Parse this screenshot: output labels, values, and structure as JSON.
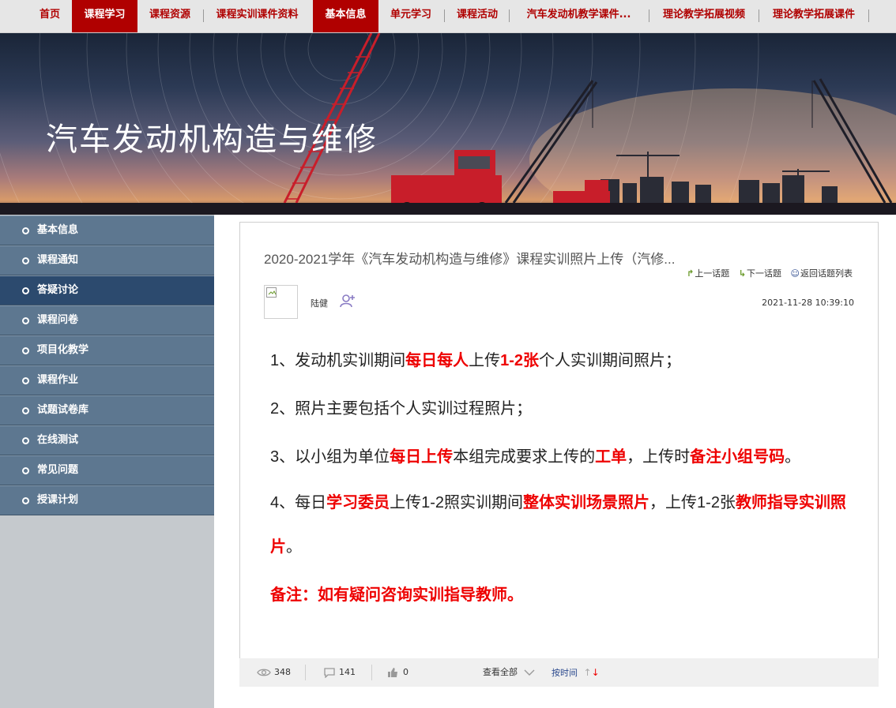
{
  "nav": {
    "items": [
      {
        "label": "首页",
        "active": false
      },
      {
        "label": "课程学习",
        "active": true
      },
      {
        "label": "课程资源",
        "active": false
      },
      {
        "label": "课程实训课件资料",
        "active": false
      },
      {
        "label": "基本信息",
        "active": true
      },
      {
        "label": "单元学习",
        "active": false
      },
      {
        "label": "课程活动",
        "active": false
      },
      {
        "label": "汽车发动机教学课件...",
        "active": false
      },
      {
        "label": "理论教学拓展视频",
        "active": false
      },
      {
        "label": "理论教学拓展课件",
        "active": false
      }
    ]
  },
  "banner": {
    "title": "汽车发动机构造与维修"
  },
  "sidebar": {
    "items": [
      {
        "label": "基本信息",
        "active": false
      },
      {
        "label": "课程通知",
        "active": false
      },
      {
        "label": "答疑讨论",
        "active": true
      },
      {
        "label": "课程问卷",
        "active": false
      },
      {
        "label": "项目化教学",
        "active": false
      },
      {
        "label": "课程作业",
        "active": false
      },
      {
        "label": "试题试卷库",
        "active": false
      },
      {
        "label": "在线测试",
        "active": false
      },
      {
        "label": "常见问题",
        "active": false
      },
      {
        "label": "授课计划",
        "active": false
      }
    ]
  },
  "post": {
    "title": "2020-2021学年《汽车发动机构造与维修》课程实训照片上传（汽修...",
    "prev_label": "上一话题",
    "next_label": "下一话题",
    "back_label": "返回话题列表",
    "author": "陆健",
    "time": "2021-11-28 10:39:10",
    "content": {
      "p1": [
        "1、发动机实训期间",
        "每日每人",
        "上传",
        "1-2张",
        "个人实训期间照片；"
      ],
      "p2": [
        "2、照片主要包括个人实训过程照片；"
      ],
      "p3": [
        "3、以小组为单位",
        "每日上传",
        "本组完成要求上传的",
        "工单",
        "，上传时",
        "备注小组号码",
        "。"
      ],
      "p4": [
        "4、每日",
        "学习委员",
        "上传1-2照实训期间",
        "整体实训场景照片",
        "，上传1-2张",
        "教师指导实训照片",
        "。"
      ],
      "p5": [
        "备注：如有疑问咨询实训指导教师。"
      ]
    }
  },
  "footer": {
    "views": "348",
    "comments": "141",
    "likes": "0",
    "view_all": "查看全部",
    "sort": "按时间"
  },
  "colors": {
    "brand_red": "#b00000",
    "highlight_red": "#ee0000",
    "sidebar_blue": "#5d7790",
    "sidebar_active": "#2c4a6e"
  }
}
